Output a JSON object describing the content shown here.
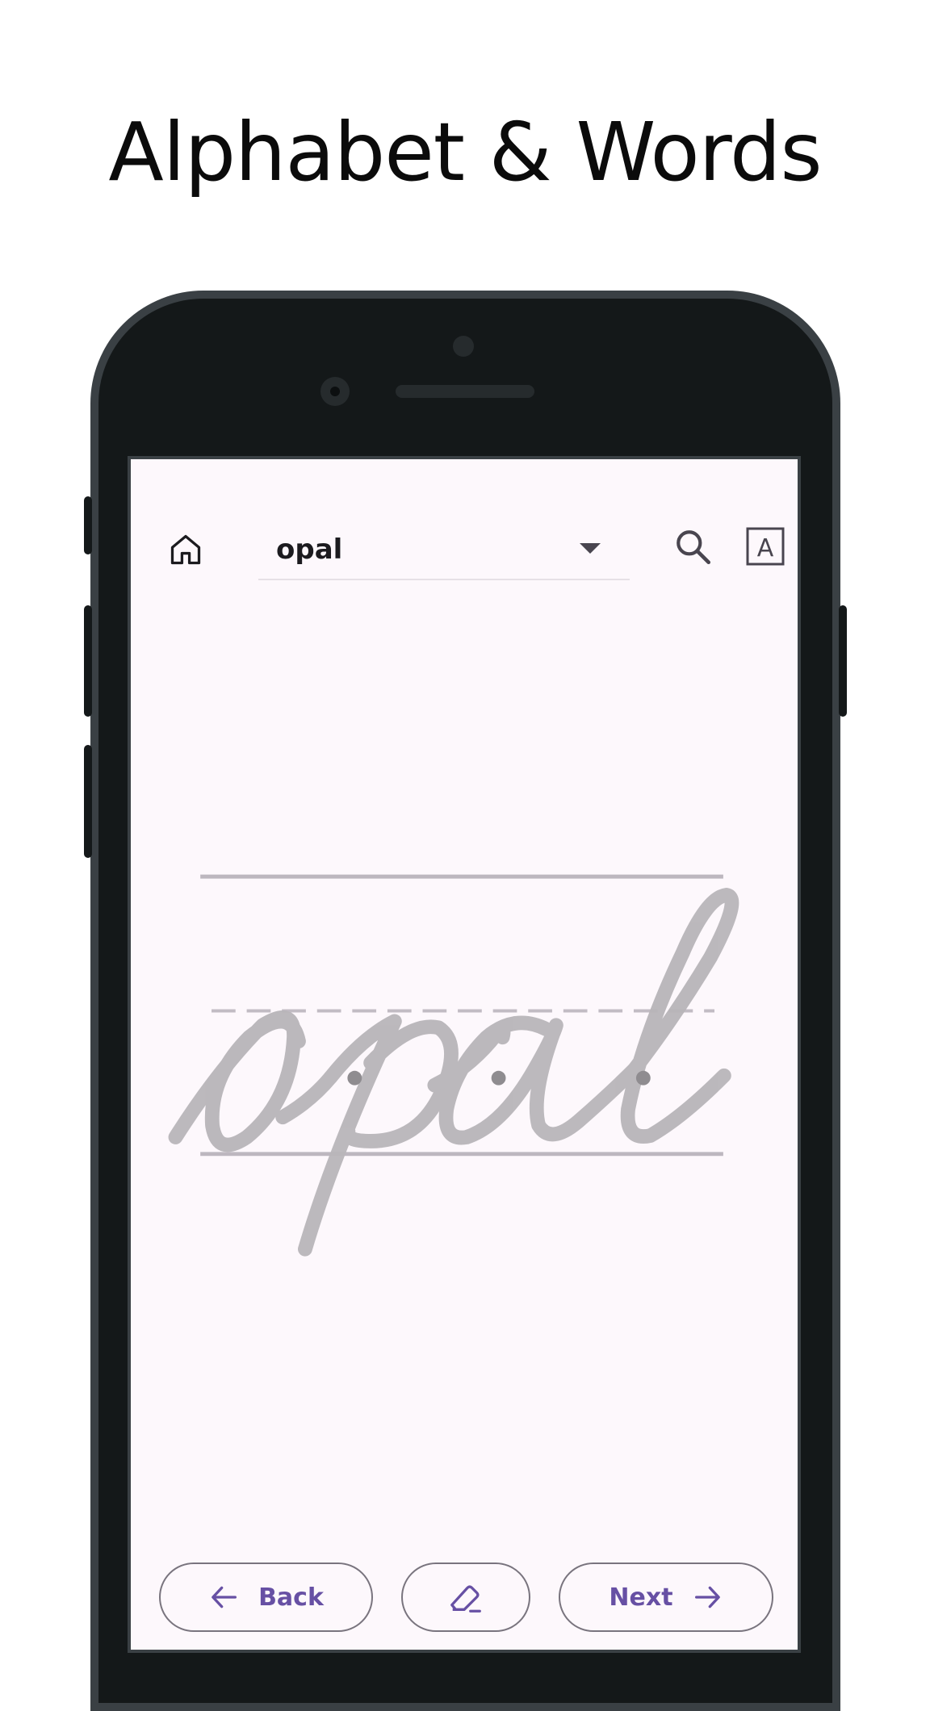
{
  "headline": "Alphabet & Words",
  "toolbar": {
    "home_icon": "home-icon",
    "selected_word": "opal",
    "dropdown_icon": "caret-down-icon",
    "search_icon": "search-icon",
    "font_icon": "font-letter-icon",
    "font_icon_glyph": "A"
  },
  "canvas": {
    "word": "opal",
    "guide_colors": {
      "solid": "#bdb7bf",
      "dashed": "#c2bcc4",
      "glyph": "#b8b5b9",
      "dots": "#8f8c90"
    }
  },
  "footer": {
    "back_label": "Back",
    "next_label": "Next",
    "clear_icon": "eraser-icon"
  },
  "colors": {
    "accent": "#6750a4",
    "screen_bg": "#fdf8fc",
    "phone_frame": "#141819"
  }
}
